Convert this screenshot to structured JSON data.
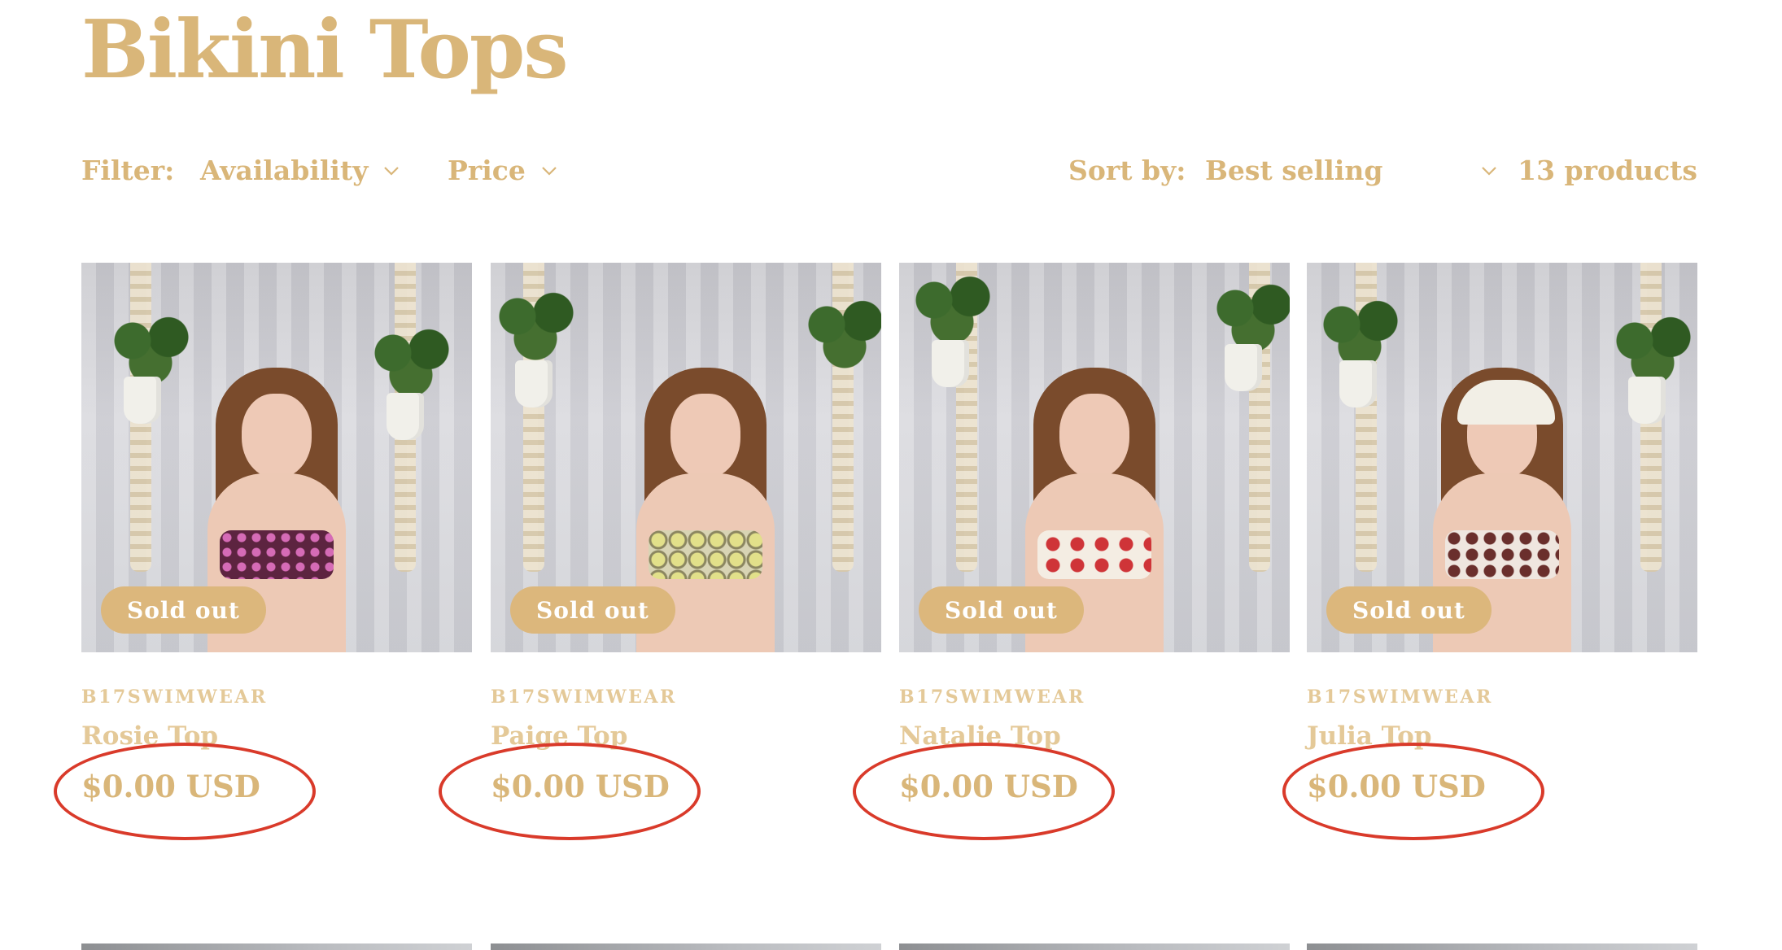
{
  "collection": {
    "title": "Bikini Tops"
  },
  "toolbar": {
    "filter_label": "Filter:",
    "filters": [
      {
        "label": "Availability",
        "icon": "chevron-down-icon"
      },
      {
        "label": "Price",
        "icon": "chevron-down-icon"
      }
    ],
    "sort_label": "Sort by:",
    "sort_value": "Best selling",
    "product_count": "13 products"
  },
  "products": [
    {
      "vendor": "B17SWIMWEAR",
      "title": "Rosie Top",
      "price": "$0.00 USD",
      "badge": "Sold out",
      "top_color": "#6b2a4a",
      "dot_color": "#d06bb0"
    },
    {
      "vendor": "B17SWIMWEAR",
      "title": "Paige Top",
      "price": "$0.00 USD",
      "badge": "Sold out",
      "top_color": "#c9c79a",
      "dot_color": "#8f8a5d"
    },
    {
      "vendor": "B17SWIMWEAR",
      "title": "Natalie Top",
      "price": "$0.00 USD",
      "badge": "Sold out",
      "top_color": "#f2ebe0",
      "dot_color": "#d0363a"
    },
    {
      "vendor": "B17SWIMWEAR",
      "title": "Julia Top",
      "price": "$0.00 USD",
      "badge": "Sold out",
      "top_color": "#efe7e0",
      "dot_color": "#6b3430"
    }
  ],
  "colors": {
    "accent_gold": "#d9b679",
    "badge_bg": "#dcb77c",
    "annotation_red": "#d93a2a"
  }
}
